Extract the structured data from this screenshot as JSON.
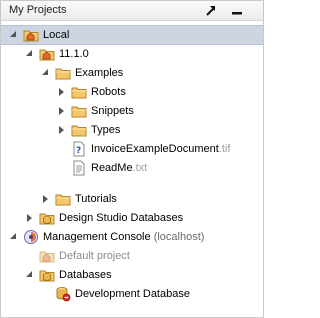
{
  "panel": {
    "title": "My Projects",
    "icons": {
      "pin": "pin-arrow-icon",
      "minimize": "minimize-icon"
    }
  },
  "tree": {
    "local": {
      "label": "Local"
    },
    "version": {
      "label": "11.1.0"
    },
    "examples": {
      "label": "Examples"
    },
    "robots": {
      "label": "Robots"
    },
    "snippets": {
      "label": "Snippets"
    },
    "types": {
      "label": "Types"
    },
    "invoice": {
      "name": "InvoiceExampleDocument",
      "ext": ".tif"
    },
    "readme": {
      "name": "ReadMe",
      "ext": ".txt"
    },
    "tutorials": {
      "label": "Tutorials"
    },
    "ds_databases": {
      "label": "Design Studio Databases"
    },
    "mgmt_console": {
      "label": "Management Console",
      "host": "(localhost)"
    },
    "default_project": {
      "label": "Default project"
    },
    "databases": {
      "label": "Databases"
    },
    "dev_database": {
      "label": "Development Database"
    }
  }
}
